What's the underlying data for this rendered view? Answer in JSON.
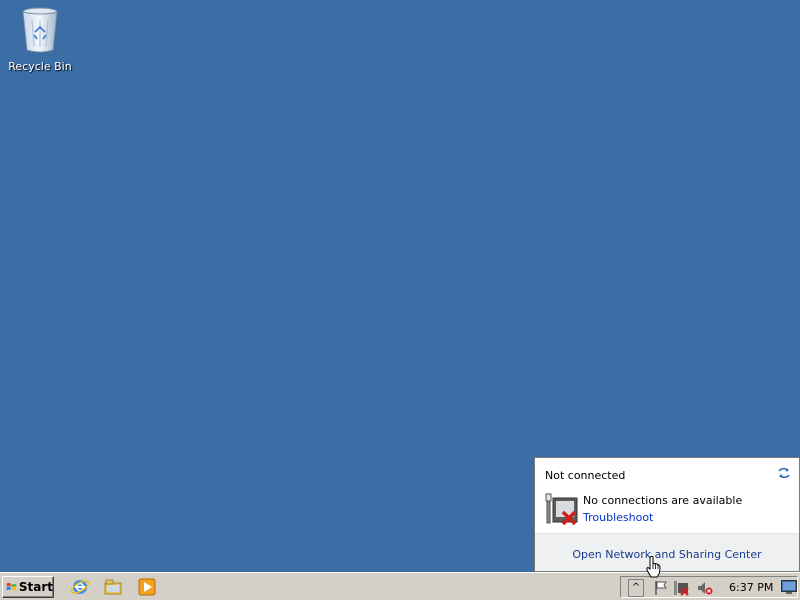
{
  "desktop": {
    "background_color": "#3a6ea5",
    "icons": [
      {
        "label": "Recycle Bin",
        "icon": "recycle-bin-icon"
      }
    ]
  },
  "taskbar": {
    "start_label": "Start",
    "quick_launch": [
      {
        "icon": "internet-explorer-icon"
      },
      {
        "icon": "windows-explorer-icon"
      },
      {
        "icon": "media-player-icon"
      }
    ],
    "tray": {
      "chevron": "^",
      "icons": [
        "action-center-flag-icon",
        "network-disconnected-icon",
        "volume-muted-icon"
      ],
      "clock": "6:37 PM"
    }
  },
  "network_flyout": {
    "status": "Not connected",
    "message": "No connections are available",
    "troubleshoot": "Troubleshoot",
    "footer_link": "Open Network and Sharing Center"
  }
}
